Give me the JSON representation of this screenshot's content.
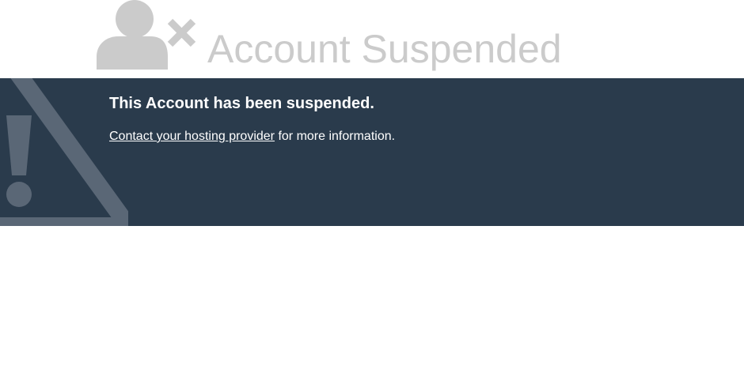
{
  "header": {
    "title": "Account Suspended",
    "icon": "user-remove-icon",
    "title_color": "#cbcbcb"
  },
  "banner": {
    "background_color": "#2a3b4c",
    "icon": "warning-triangle-icon",
    "heading": "This Account has been suspended.",
    "link_text": "Contact your hosting provider",
    "text_after_link": " for more information."
  }
}
